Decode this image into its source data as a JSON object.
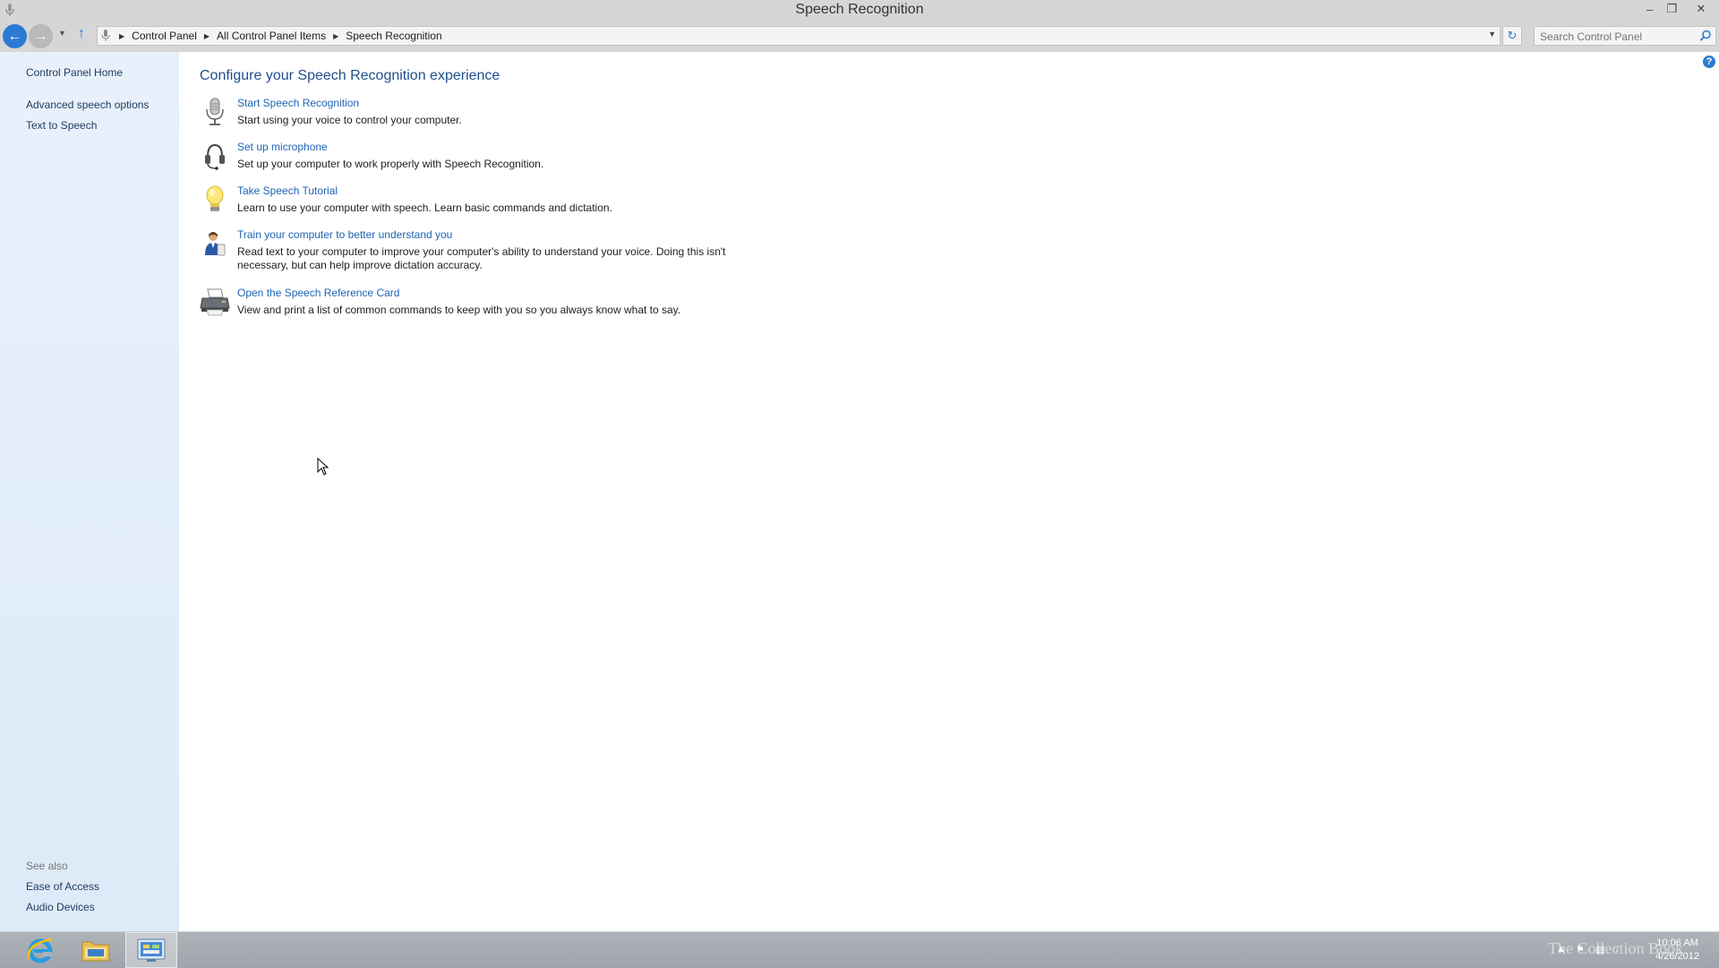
{
  "window": {
    "title": "Speech Recognition",
    "minimize_label": "–",
    "restore_label": "❐",
    "close_label": "✕"
  },
  "nav": {
    "breadcrumbs": [
      "Control Panel",
      "All Control Panel Items",
      "Speech Recognition"
    ],
    "search_placeholder": "Search Control Panel"
  },
  "sidebar": {
    "home": "Control Panel Home",
    "items": [
      "Advanced speech options",
      "Text to Speech"
    ],
    "see_also_label": "See also",
    "see_also": [
      "Ease of Access",
      "Audio Devices"
    ]
  },
  "main": {
    "heading": "Configure your Speech Recognition experience",
    "tasks": [
      {
        "icon": "microphone-icon",
        "link": "Start Speech Recognition",
        "desc": "Start using your voice to control your computer."
      },
      {
        "icon": "headset-icon",
        "link": "Set up microphone",
        "desc": "Set up your computer to work properly with Speech Recognition."
      },
      {
        "icon": "lightbulb-icon",
        "link": "Take Speech Tutorial",
        "desc": "Learn to use your computer with speech.  Learn basic commands and dictation."
      },
      {
        "icon": "user-train-icon",
        "link": "Train your computer to better understand you",
        "desc": "Read text to your computer to improve your computer's ability to understand your voice.  Doing this isn't necessary, but can help improve dictation accuracy."
      },
      {
        "icon": "printer-icon",
        "link": "Open the Speech Reference Card",
        "desc": "View and print a list of common commands to keep with you so you always know what to say."
      }
    ]
  },
  "taskbar": {
    "time": "10:06 AM",
    "date": "4/26/2012",
    "watermark": "The Collection Book"
  }
}
